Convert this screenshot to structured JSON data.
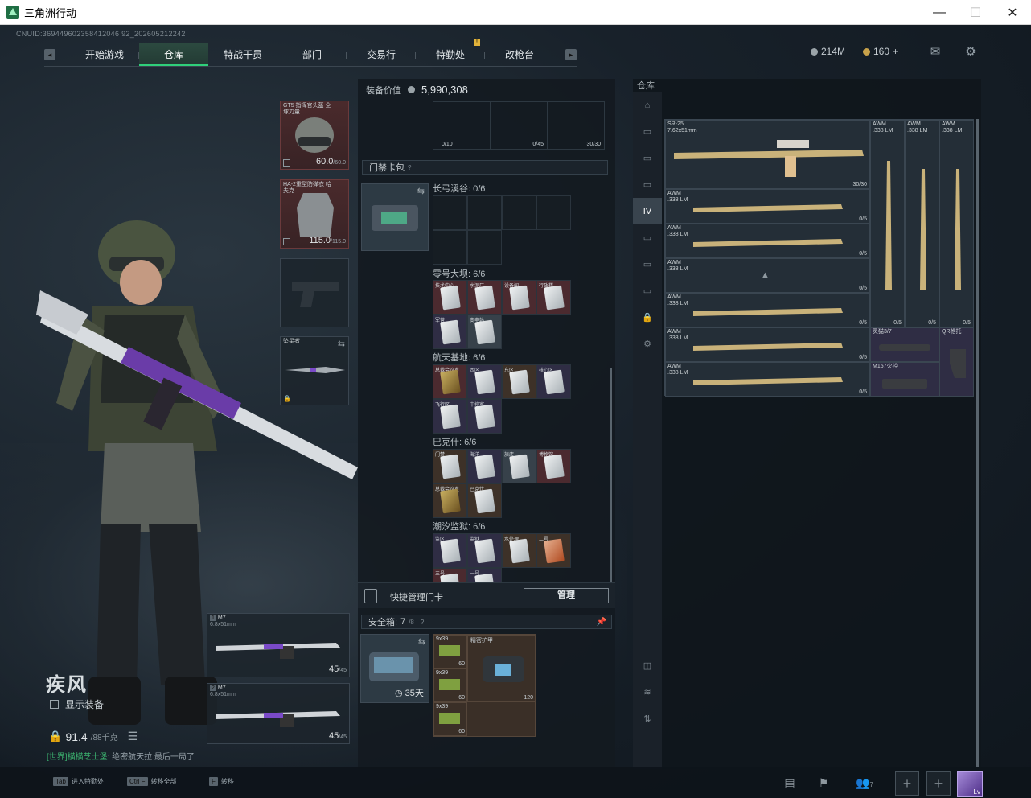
{
  "window": {
    "title": "三角洲行动",
    "controls": [
      "—",
      "☐",
      "✕"
    ]
  },
  "uid": "CNUID:369449602358412046 92_202605212242",
  "nav": {
    "tabs": [
      "开始游戏",
      "仓库",
      "特战干员",
      "部门",
      "交易行",
      "特勤处",
      "改枪台"
    ],
    "active": "仓库",
    "badge_tab": "特勤处",
    "badge_text": "!"
  },
  "currency": {
    "credits": "214M",
    "coins": "160",
    "plus": "+"
  },
  "character": {
    "name": "疾风",
    "show_equipment": "显示装备",
    "weight": "91.4",
    "weight_max": "/88千克"
  },
  "chat": {
    "channel": "[世界]",
    "user": "横横芝士堡",
    "message": ": 绝密航天拉 最后一局了"
  },
  "equipment": {
    "helmet": {
      "name": "GT5 指挥官头盔 全球力量",
      "durability": "60.0",
      "max": "/60.0"
    },
    "armor": {
      "name": "HA-2重型防弹衣 哈夫克",
      "durability": "115.0",
      "max": "/115.0"
    },
    "melee": {
      "name": "坠星者"
    },
    "primary1": {
      "index": "1",
      "name": "M7",
      "caliber": "6.8x51mm",
      "ammo": "45",
      "ammo_max": "/45"
    },
    "primary2": {
      "index": "2",
      "name": "M7",
      "caliber": "6.8x51mm",
      "ammo": "45",
      "ammo_max": "/45"
    }
  },
  "center": {
    "equip_value_label": "装备价值",
    "equip_value": "5,990,308",
    "top_counts": [
      "0/10",
      "0/45",
      "30/30"
    ],
    "keycase_title": "门禁卡包",
    "keycase_help": "?",
    "regions": [
      {
        "name": "长弓溪谷: 0/6"
      },
      {
        "name": "零号大坝: 6/6",
        "cards": [
          "技术中心",
          "水泥厂",
          "设备间",
          "行政楼",
          "军营",
          "变电站"
        ]
      },
      {
        "name": "航天基地: 6/6",
        "cards": [
          "总裁会议室",
          "西区",
          "东区",
          "核心区",
          "飞行区",
          "中控室"
        ]
      },
      {
        "name": "巴克什: 6/6",
        "cards": [
          "门禁",
          "海洋",
          "旅店",
          "博物馆",
          "总裁会议室",
          "巴克什"
        ]
      },
      {
        "name": "潮汐监狱: 6/6",
        "cards": [
          "监区",
          "监狱",
          "水处理",
          "二号",
          "三号",
          "一号"
        ]
      }
    ],
    "quick_manage": "快捷管理门卡",
    "manage_btn": "管理",
    "safe_box": {
      "label": "安全箱:",
      "count": "7",
      "count_max": "/8",
      "help": "?",
      "days": "35天"
    },
    "safe_items": [
      {
        "name": "9x39",
        "count": "60"
      },
      {
        "name": "9x39",
        "count": "60"
      },
      {
        "name": "9x39",
        "count": "60"
      },
      {
        "name": "9x39",
        "count": "60"
      },
      {
        "name": "精密护甲",
        "count": "120"
      }
    ]
  },
  "stash": {
    "title": "仓库",
    "items": [
      {
        "name": "SR-25",
        "caliber": "7.62x51mm",
        "count": "30/30"
      },
      {
        "name": "AWM",
        "caliber": ".338 LM",
        "count": "0/5"
      },
      {
        "name": "AWM",
        "caliber": ".338 LM",
        "count": "0/5"
      },
      {
        "name": "AWM",
        "caliber": ".338 LM",
        "count": "0/5"
      },
      {
        "name": "AWM",
        "caliber": ".338 LM",
        "count": "0/5"
      },
      {
        "name": "AWM",
        "caliber": ".338 LM",
        "count": "0/5"
      },
      {
        "name": "AWM",
        "caliber": ".338 LM",
        "count": "0/5"
      },
      {
        "name": "AWM",
        "caliber": ".338 LM",
        "count": "0/5"
      },
      {
        "name": "AWM",
        "caliber": ".338 LM",
        "count": "0/5"
      },
      {
        "name": "AWM",
        "caliber": ".338 LM",
        "count": "0/5"
      },
      {
        "name": "灵猫3/7",
        "caliber": "",
        "count": ""
      },
      {
        "name": "QR枪托",
        "caliber": "",
        "count": ""
      },
      {
        "name": "M157火控",
        "caliber": "",
        "count": ""
      }
    ]
  },
  "bottom": {
    "hints": [
      {
        "key": "Tab",
        "label": "进入特勤处"
      },
      {
        "key": "Ctrl F",
        "label": "转移全部"
      },
      {
        "key": "F",
        "label": "转移"
      }
    ],
    "friends": "7",
    "avatar_level": "Lv"
  },
  "colors": {
    "accent": "#2fd07a",
    "red_slot": "#4b2a2f"
  }
}
